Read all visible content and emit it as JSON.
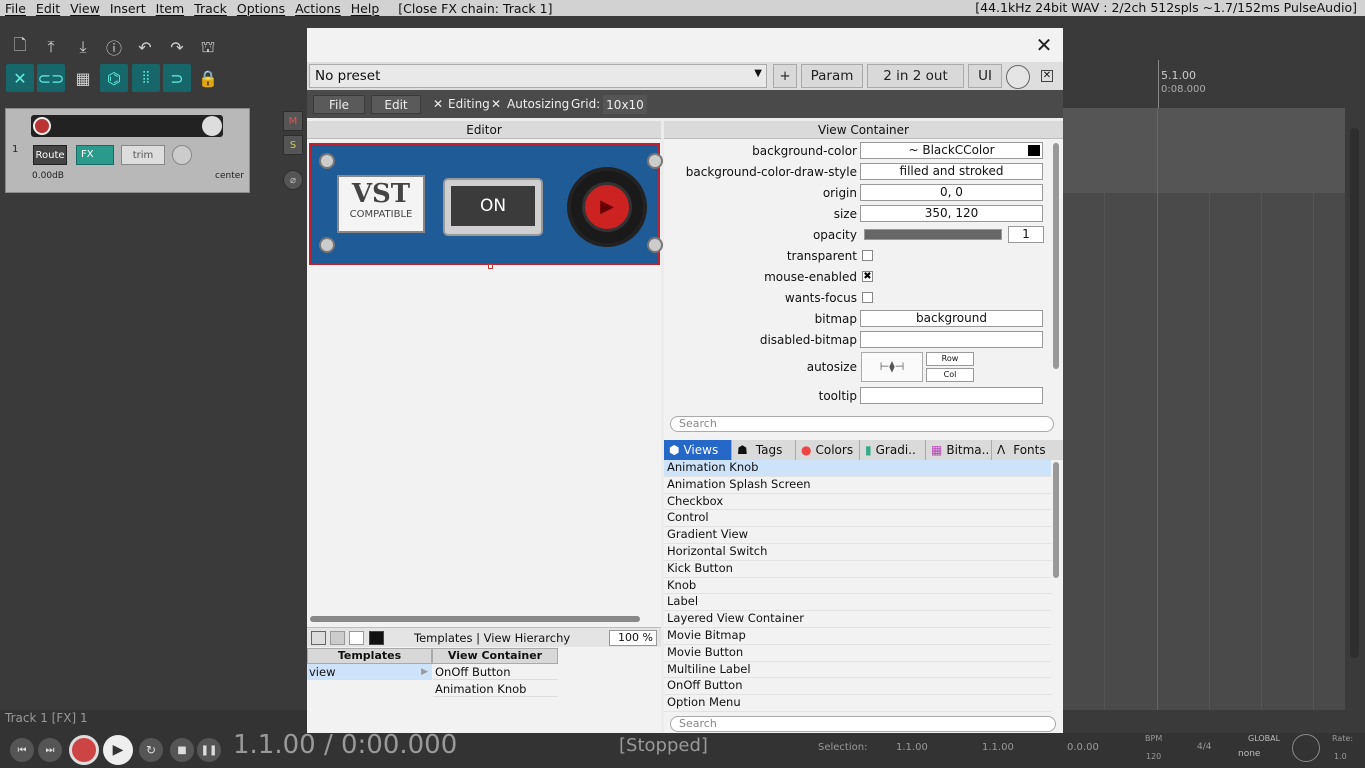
{
  "menubar": {
    "items": [
      "File",
      "Edit",
      "View",
      "Insert",
      "Item",
      "Track",
      "Options",
      "Actions",
      "Help"
    ],
    "title": "[Close FX chain: Track 1]",
    "status": "[44.1kHz 24bit WAV : 2/2ch 512spls ~1.7/152ms PulseAudio]"
  },
  "track": {
    "number": "1",
    "route": "Route",
    "fx": "FX",
    "trim": "trim",
    "volume": "0.00dB",
    "pan": "center",
    "mute": "M",
    "solo": "S"
  },
  "timeline": {
    "bar": "5.1.00",
    "time": "0:08.000"
  },
  "statusbar": {
    "text": "Track 1 [FX] 1"
  },
  "transport": {
    "position": "1.1.00 / 0:00.000",
    "state": "[Stopped]",
    "selection_label": "Selection:",
    "sel_start": "1.1.00",
    "sel_end": "1.1.00",
    "sel_len": "0.0.00",
    "bpm_label": "BPM",
    "bpm": "120",
    "timesig": "4/4",
    "global_label": "GLOBAL",
    "global_value": "none",
    "rate_label": "Rate:",
    "rate": "1.0"
  },
  "fx": {
    "preset": "No preset",
    "add": "+",
    "param": "Param",
    "io": "2 in 2 out",
    "ui": "UI",
    "menu": {
      "file": "File",
      "edit": "Edit",
      "editing": "Editing",
      "autosizing": "Autosizing",
      "grid_label": "Grid:",
      "grid_value": "10x10"
    },
    "editor_header": "Editor",
    "plugin": {
      "logo": "VST",
      "logo_sub": "COMPATIBLE",
      "button": "ON"
    },
    "bottom": {
      "title": "Templates | View Hierarchy",
      "zoom": "100 %",
      "col1": "Templates",
      "col2": "View Container",
      "row_template": "view",
      "rows": [
        "OnOff Button",
        "Animation Knob"
      ]
    },
    "inspector": {
      "header": "View Container",
      "props": [
        {
          "label": "background-color",
          "value": "~ BlackCColor"
        },
        {
          "label": "background-color-draw-style",
          "value": "filled and stroked"
        },
        {
          "label": "origin",
          "value": "0, 0"
        },
        {
          "label": "size",
          "value": "350, 120"
        },
        {
          "label": "opacity",
          "value": "1"
        },
        {
          "label": "transparent",
          "value": ""
        },
        {
          "label": "mouse-enabled",
          "value": "✖"
        },
        {
          "label": "wants-focus",
          "value": ""
        },
        {
          "label": "bitmap",
          "value": "background"
        },
        {
          "label": "disabled-bitmap",
          "value": ""
        },
        {
          "label": "autosize",
          "value": ""
        },
        {
          "label": "tooltip",
          "value": ""
        }
      ],
      "autosize_row": "Row",
      "autosize_col": "Col",
      "search": "Search"
    },
    "tabs": [
      "Views",
      "Tags",
      "Colors",
      "Gradi..",
      "Bitma..",
      "Fonts"
    ],
    "views": [
      "Animation Knob",
      "Animation Splash Screen",
      "Checkbox",
      "Control",
      "Gradient View",
      "Horizontal Switch",
      "Kick Button",
      "Knob",
      "Label",
      "Layered View Container",
      "Movie Bitmap",
      "Movie Button",
      "Multiline Label",
      "OnOff Button",
      "Option Menu"
    ],
    "views_search": "Search"
  }
}
